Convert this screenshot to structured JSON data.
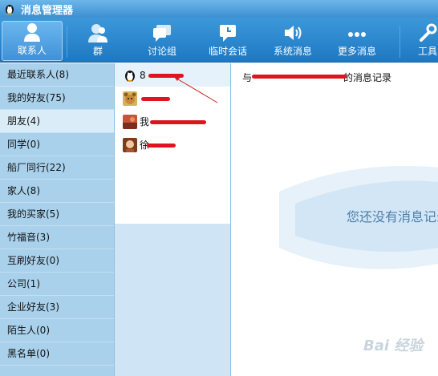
{
  "window": {
    "title": "消息管理器"
  },
  "toolbar": {
    "items": [
      {
        "label": "联系人",
        "icon": "contact-person-icon",
        "active": true
      },
      {
        "label": "群",
        "icon": "group-icon"
      },
      {
        "label": "讨论组",
        "icon": "discussion-icon"
      },
      {
        "label": "临时会话",
        "icon": "temp-session-icon"
      },
      {
        "label": "系统消息",
        "icon": "speaker-icon"
      },
      {
        "label": "更多消息",
        "icon": "more-dots-icon"
      },
      {
        "label": "工具",
        "icon": "wrench-icon"
      }
    ]
  },
  "sidebar": {
    "items": [
      {
        "label": "最近联系人(8)"
      },
      {
        "label": "我的好友(75)"
      },
      {
        "label": "朋友(4)",
        "selected": true
      },
      {
        "label": "同学(0)"
      },
      {
        "label": "船厂同行(22)"
      },
      {
        "label": "家人(8)"
      },
      {
        "label": "我的买家(5)"
      },
      {
        "label": "竹福音(3)"
      },
      {
        "label": "互刷好友(0)"
      },
      {
        "label": "公司(1)"
      },
      {
        "label": "企业好友(3)"
      },
      {
        "label": "陌生人(0)"
      },
      {
        "label": "黑名单(0)"
      }
    ]
  },
  "contacts": {
    "items": [
      {
        "name": "8",
        "avatar": "qq-penguin-avatar",
        "selected": true
      },
      {
        "name": "",
        "avatar": "bear-avatar"
      },
      {
        "name": "我",
        "avatar": "landscape-avatar"
      },
      {
        "name": "徐",
        "avatar": "photo-avatar"
      }
    ]
  },
  "content": {
    "record_prefix": "与",
    "record_suffix": "的消息记录",
    "empty_message": "您还没有消息记录",
    "watermark": "Bai 经验"
  },
  "colors": {
    "accent": "#2a86cd",
    "sidebar_bg": "#a9d1ec",
    "redaction": "#e0141e"
  }
}
